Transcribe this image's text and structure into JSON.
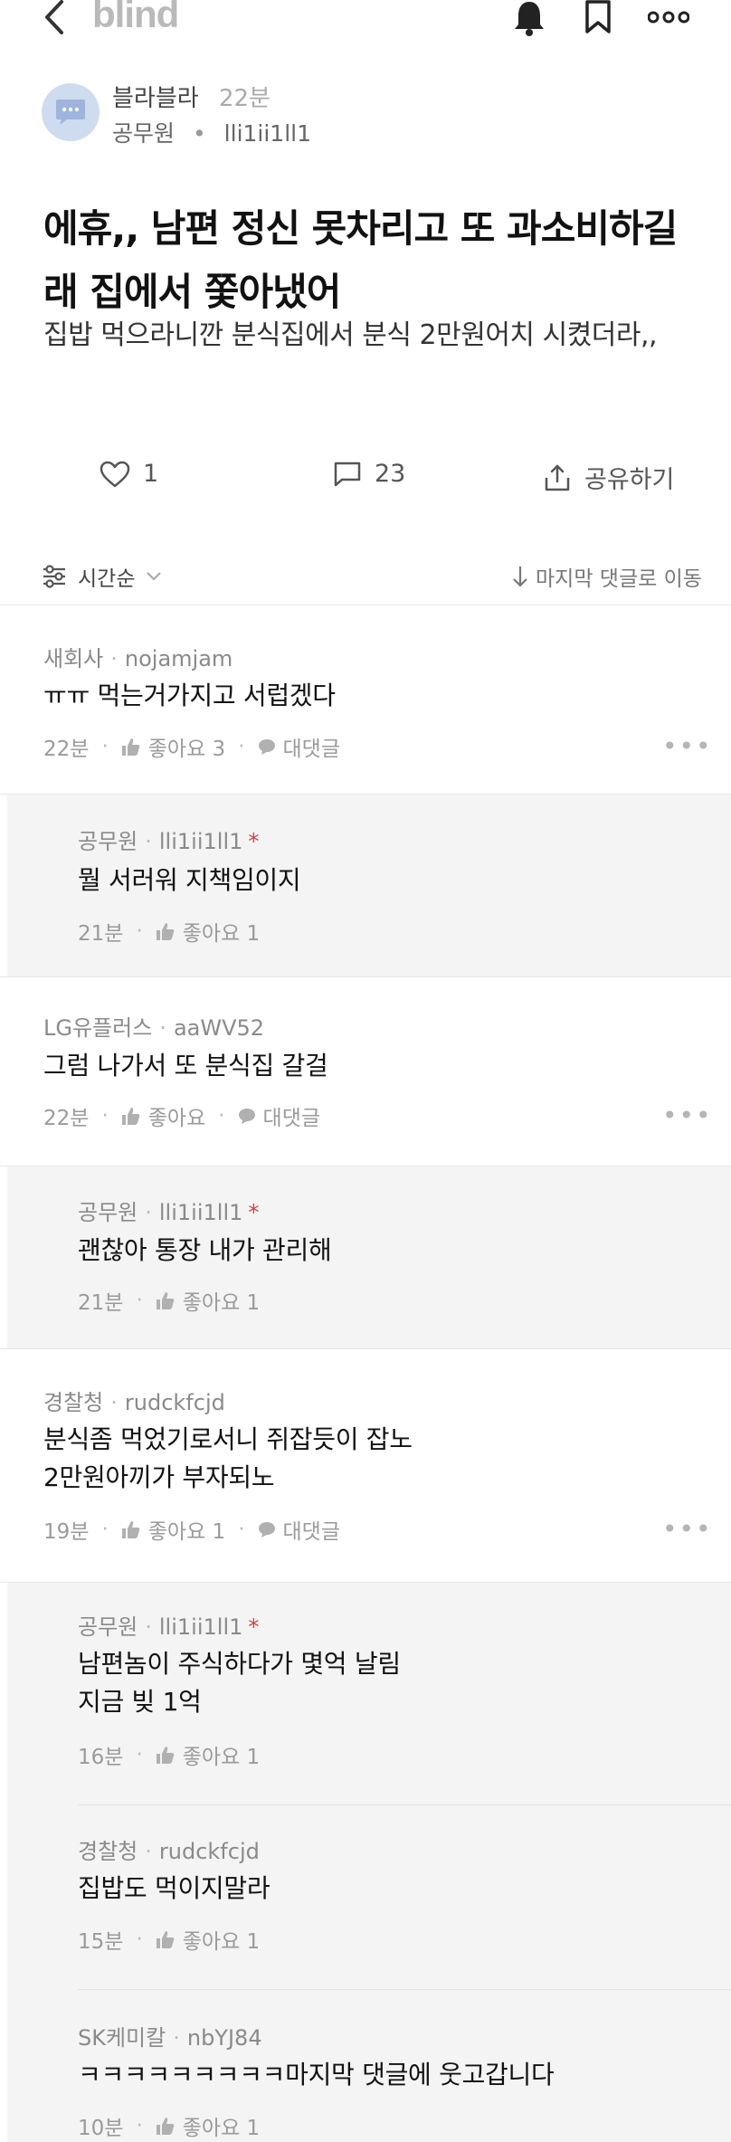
{
  "topbar": {
    "logo": "blind"
  },
  "post": {
    "author": "블라블라",
    "time": "22분",
    "company": "공무원",
    "nickname": "lli1ii1ll1",
    "title": "에휴,, 남편 정신 못차리고 또 과소비하길래 집에서 쫓아냈어",
    "body": "집밥 먹으라니깐 분식집에서 분식 2만원어치 시켰더라,,"
  },
  "actions": {
    "likes": "1",
    "comments": "23",
    "share": "공유하기"
  },
  "sort": {
    "label": "시간순",
    "jump": "마지막 댓글로 이동"
  },
  "comments": [
    {
      "company": "새회사",
      "nick": "nojamjam",
      "text1": "ㅠㅠ 먹는거가지고 서럽겠다",
      "text2": "",
      "time": "22분",
      "like": "좋아요 3",
      "reply": "대댓글"
    },
    {
      "company": "공무원",
      "nick": "lli1ii1ll1",
      "star": "*",
      "text1": "뭘 서러워 지책임이지",
      "text2": "",
      "time": "21분",
      "like": "좋아요 1"
    },
    {
      "company": "LG유플러스",
      "nick": "aaWV52",
      "text1": "그럼 나가서 또 분식집 갈걸",
      "text2": "",
      "time": "22분",
      "like": "좋아요",
      "reply": "대댓글"
    },
    {
      "company": "공무원",
      "nick": "lli1ii1ll1",
      "star": "*",
      "text1": "괜찮아 통장 내가 관리해",
      "text2": "",
      "time": "21분",
      "like": "좋아요 1"
    },
    {
      "company": "경찰청",
      "nick": "rudckfcjd",
      "text1": "분식좀 먹었기로서니 쥐잡듯이 잡노",
      "text2": "2만원아끼가 부자되노",
      "time": "19분",
      "like": "좋아요 1",
      "reply": "대댓글"
    },
    {
      "company": "공무원",
      "nick": "lli1ii1ll1",
      "star": "*",
      "text1": "남편놈이 주식하다가 몇억 날림",
      "text2": "지금 빚 1억",
      "time": "16분",
      "like": "좋아요 1"
    },
    {
      "company": "경찰청",
      "nick": "rudckfcjd",
      "text1": "집밥도 먹이지말라",
      "text2": "",
      "time": "15분",
      "like": "좋아요 1"
    },
    {
      "company": "SK케미칼",
      "nick": "nbYJ84",
      "text1": "ㅋㅋㅋㅋㅋㅋㅋㅋㅋ마지막 댓글에 웃고갑니다",
      "text2": "",
      "time": "10분",
      "like": "좋아요 1"
    }
  ]
}
